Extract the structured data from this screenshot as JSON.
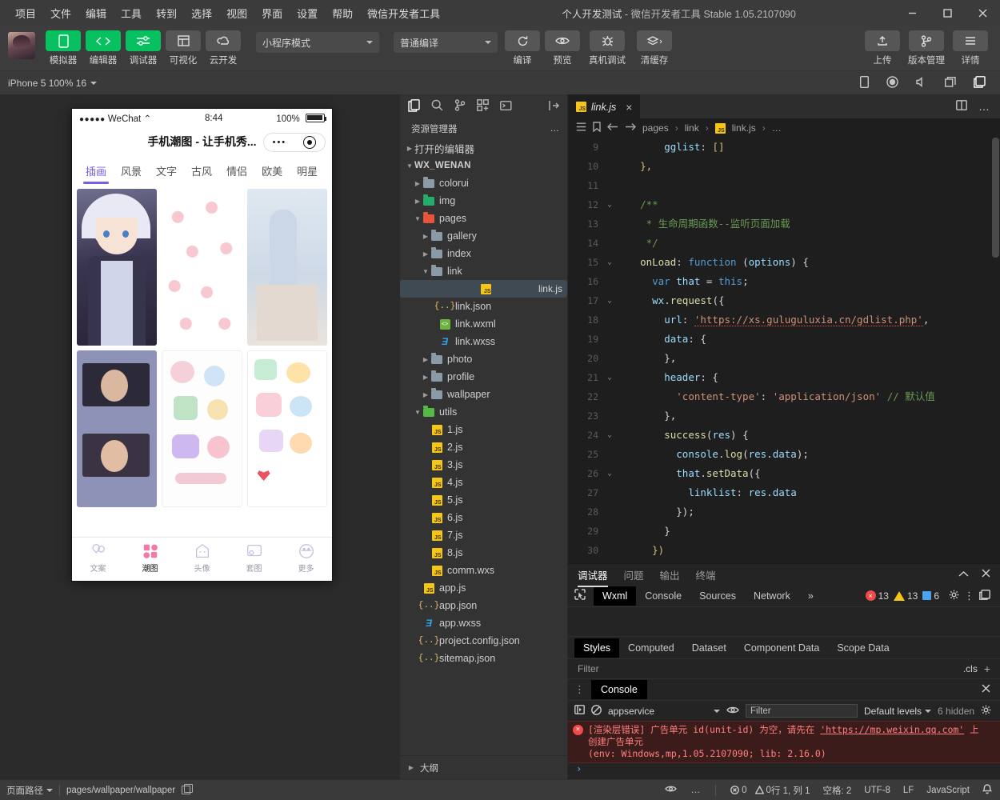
{
  "window": {
    "menus": [
      "项目",
      "文件",
      "编辑",
      "工具",
      "转到",
      "选择",
      "视图",
      "界面",
      "设置",
      "帮助",
      "微信开发者工具"
    ],
    "title_project": "个人开发测试",
    "title_rest": " - 微信开发者工具 Stable 1.05.2107090",
    "minimize": "minimize-icon",
    "maximize": "maximize-icon",
    "close": "close-icon"
  },
  "toolbar": {
    "tools": [
      {
        "label": "模拟器",
        "icon": "phone-icon",
        "style": "green"
      },
      {
        "label": "编辑器",
        "icon": "code-icon",
        "style": "green"
      },
      {
        "label": "调试器",
        "icon": "sliders-icon",
        "style": "green"
      },
      {
        "label": "可视化",
        "icon": "layout-icon",
        "style": "grey"
      },
      {
        "label": "云开发",
        "icon": "cloud-icon",
        "style": "grey"
      }
    ],
    "mode_select": "小程序模式",
    "compile_select": "普通编译",
    "actions": [
      {
        "label": "编译",
        "icon": "refresh-icon"
      },
      {
        "label": "预览",
        "icon": "eye-icon"
      },
      {
        "label": "真机调试",
        "icon": "bug-icon"
      },
      {
        "label": "清缓存",
        "icon": "layers-icon"
      }
    ],
    "right_actions": [
      {
        "label": "上传",
        "icon": "upload-icon"
      },
      {
        "label": "版本管理",
        "icon": "git-branch-icon"
      },
      {
        "label": "详情",
        "icon": "hamburger-icon"
      }
    ]
  },
  "simbar": {
    "device": "iPhone 5 100% 16",
    "icons": [
      "phone-rotate-icon",
      "record-icon",
      "volume-icon",
      "window-icon",
      "split-icon"
    ]
  },
  "simulator": {
    "status": {
      "carrier": "WeChat",
      "dots": "●●●●●",
      "time": "8:44",
      "battery_pct": "100%"
    },
    "nav_title": "手机潮图 - 让手机秀...",
    "tabs": [
      "插画",
      "风景",
      "文字",
      "古风",
      "情侣",
      "欧美",
      "明星"
    ],
    "active_tab": "插画",
    "tabbar": [
      {
        "label": "文案",
        "icon": "balloon-icon"
      },
      {
        "label": "潮图",
        "icon": "grid-icon"
      },
      {
        "label": "头像",
        "icon": "avatar-icon"
      },
      {
        "label": "套图",
        "icon": "album-icon"
      },
      {
        "label": "更多",
        "icon": "more-icon"
      }
    ],
    "active_tabbar": "潮图"
  },
  "explorer": {
    "icons": [
      "files-icon",
      "search-icon",
      "source-control-icon",
      "extensions-icon",
      "debug-icon",
      "collapse-icon"
    ],
    "title": "资源管理器",
    "more": "…",
    "open_editors": "打开的编辑器",
    "project_name": "WX_WENAN",
    "tree": [
      {
        "name": "colorui",
        "depth": 2,
        "type": "folder",
        "open": false
      },
      {
        "name": "img",
        "depth": 2,
        "type": "folder-img",
        "open": false
      },
      {
        "name": "pages",
        "depth": 2,
        "type": "folder-pages",
        "open": true
      },
      {
        "name": "gallery",
        "depth": 3,
        "type": "folder",
        "open": false
      },
      {
        "name": "index",
        "depth": 3,
        "type": "folder",
        "open": false
      },
      {
        "name": "link",
        "depth": 3,
        "type": "folder",
        "open": true
      },
      {
        "name": "link.js",
        "depth": 4,
        "type": "js",
        "selected": true
      },
      {
        "name": "link.json",
        "depth": 4,
        "type": "json"
      },
      {
        "name": "link.wxml",
        "depth": 4,
        "type": "wxml"
      },
      {
        "name": "link.wxss",
        "depth": 4,
        "type": "wxss"
      },
      {
        "name": "photo",
        "depth": 3,
        "type": "folder",
        "open": false
      },
      {
        "name": "profile",
        "depth": 3,
        "type": "folder",
        "open": false
      },
      {
        "name": "wallpaper",
        "depth": 3,
        "type": "folder",
        "open": false
      },
      {
        "name": "utils",
        "depth": 2,
        "type": "folder-utils",
        "open": true
      },
      {
        "name": "1.js",
        "depth": 3,
        "type": "js"
      },
      {
        "name": "2.js",
        "depth": 3,
        "type": "js"
      },
      {
        "name": "3.js",
        "depth": 3,
        "type": "js"
      },
      {
        "name": "4.js",
        "depth": 3,
        "type": "js"
      },
      {
        "name": "5.js",
        "depth": 3,
        "type": "js"
      },
      {
        "name": "6.js",
        "depth": 3,
        "type": "js"
      },
      {
        "name": "7.js",
        "depth": 3,
        "type": "js"
      },
      {
        "name": "8.js",
        "depth": 3,
        "type": "js"
      },
      {
        "name": "comm.wxs",
        "depth": 3,
        "type": "js"
      },
      {
        "name": "app.js",
        "depth": 2,
        "type": "js"
      },
      {
        "name": "app.json",
        "depth": 2,
        "type": "json"
      },
      {
        "name": "app.wxss",
        "depth": 2,
        "type": "wxss"
      },
      {
        "name": "project.config.json",
        "depth": 2,
        "type": "json"
      },
      {
        "name": "sitemap.json",
        "depth": 2,
        "type": "json"
      }
    ],
    "outline": "大纲"
  },
  "editor": {
    "tab": {
      "name": "link.js",
      "icon": "js-icon",
      "close": "×"
    },
    "tab_right_icons": [
      "split-editor-icon",
      "more-icon"
    ],
    "breadcrumb_icons": [
      "outline-icon",
      "bookmark-icon",
      "back-arrow-icon",
      "forward-arrow-icon"
    ],
    "breadcrumb": [
      "pages",
      "link",
      "link.js",
      "…"
    ],
    "lines": [
      {
        "n": "9",
        "fold": "",
        "indent": 4,
        "tokens": [
          [
            "k-key",
            "gglist"
          ],
          [
            "k-pun",
            ": "
          ],
          [
            "k-org",
            "[]"
          ]
        ]
      },
      {
        "n": "10",
        "fold": "",
        "indent": 2,
        "tokens": [
          [
            "k-org",
            "},"
          ]
        ]
      },
      {
        "n": "11",
        "fold": "",
        "indent": 0,
        "tokens": []
      },
      {
        "n": "12",
        "fold": "v",
        "indent": 2,
        "tokens": [
          [
            "k-cmt",
            "/**"
          ]
        ]
      },
      {
        "n": "13",
        "fold": "",
        "indent": 2,
        "tokens": [
          [
            "k-cmt",
            " * 生命周期函数--监听页面加载"
          ]
        ]
      },
      {
        "n": "14",
        "fold": "",
        "indent": 2,
        "tokens": [
          [
            "k-cmt",
            " */"
          ]
        ]
      },
      {
        "n": "15",
        "fold": "v",
        "indent": 2,
        "tokens": [
          [
            "k-y",
            "onLoad"
          ],
          [
            "k-pun",
            ": "
          ],
          [
            "k-blue",
            "function"
          ],
          [
            "k-pun",
            " ("
          ],
          [
            "k-key",
            "options"
          ],
          [
            "k-pun",
            ") {"
          ]
        ]
      },
      {
        "n": "16",
        "fold": "",
        "indent": 3,
        "tokens": [
          [
            "k-blue",
            "var"
          ],
          [
            "k-pun",
            " "
          ],
          [
            "k-key",
            "that"
          ],
          [
            "k-pun",
            " = "
          ],
          [
            "k-blue",
            "this"
          ],
          [
            "k-pun",
            ";"
          ]
        ]
      },
      {
        "n": "17",
        "fold": "v",
        "indent": 3,
        "tokens": [
          [
            "k-key",
            "wx"
          ],
          [
            "k-pun",
            "."
          ],
          [
            "k-y",
            "request"
          ],
          [
            "k-pun",
            "({"
          ]
        ]
      },
      {
        "n": "18",
        "fold": "",
        "indent": 4,
        "tokens": [
          [
            "k-key",
            "url"
          ],
          [
            "k-pun",
            ": "
          ],
          [
            "k-str-err",
            "'https://xs.guluguluxia.cn/gdlist.php'"
          ],
          [
            "k-pun",
            ","
          ]
        ]
      },
      {
        "n": "19",
        "fold": "",
        "indent": 4,
        "tokens": [
          [
            "k-key",
            "data"
          ],
          [
            "k-pun",
            ": {"
          ]
        ]
      },
      {
        "n": "20",
        "fold": "",
        "indent": 4,
        "tokens": [
          [
            "k-pun",
            "},"
          ]
        ]
      },
      {
        "n": "21",
        "fold": "v",
        "indent": 4,
        "tokens": [
          [
            "k-key",
            "header"
          ],
          [
            "k-pun",
            ": {"
          ]
        ]
      },
      {
        "n": "22",
        "fold": "",
        "indent": 5,
        "tokens": [
          [
            "k-str",
            "'content-type'"
          ],
          [
            "k-pun",
            ": "
          ],
          [
            "k-str",
            "'application/json'"
          ],
          [
            "k-pun",
            " "
          ],
          [
            "k-cmt",
            "// 默认值"
          ]
        ]
      },
      {
        "n": "23",
        "fold": "",
        "indent": 4,
        "tokens": [
          [
            "k-pun",
            "},"
          ]
        ]
      },
      {
        "n": "24",
        "fold": "v",
        "indent": 4,
        "tokens": [
          [
            "k-y",
            "success"
          ],
          [
            "k-pun",
            "("
          ],
          [
            "k-key",
            "res"
          ],
          [
            "k-pun",
            ") {"
          ]
        ]
      },
      {
        "n": "25",
        "fold": "",
        "indent": 5,
        "tokens": [
          [
            "k-key",
            "console"
          ],
          [
            "k-pun",
            "."
          ],
          [
            "k-y",
            "log"
          ],
          [
            "k-pun",
            "("
          ],
          [
            "k-key",
            "res"
          ],
          [
            "k-pun",
            "."
          ],
          [
            "k-key",
            "data"
          ],
          [
            "k-pun",
            ");"
          ]
        ]
      },
      {
        "n": "26",
        "fold": "v",
        "indent": 5,
        "tokens": [
          [
            "k-key",
            "that"
          ],
          [
            "k-pun",
            "."
          ],
          [
            "k-y",
            "setData"
          ],
          [
            "k-pun",
            "({"
          ]
        ]
      },
      {
        "n": "27",
        "fold": "",
        "indent": 6,
        "tokens": [
          [
            "k-key",
            "linklist"
          ],
          [
            "k-pun",
            ": "
          ],
          [
            "k-key",
            "res"
          ],
          [
            "k-pun",
            "."
          ],
          [
            "k-key",
            "data"
          ]
        ]
      },
      {
        "n": "28",
        "fold": "",
        "indent": 5,
        "tokens": [
          [
            "k-pun",
            "});"
          ]
        ]
      },
      {
        "n": "29",
        "fold": "",
        "indent": 4,
        "tokens": [
          [
            "k-pun",
            "}"
          ]
        ]
      },
      {
        "n": "30",
        "fold": "",
        "indent": 3,
        "tokens": [
          [
            "k-org",
            "})"
          ]
        ]
      }
    ]
  },
  "debugger": {
    "panel_tabs": [
      "调试器",
      "问题",
      "输出",
      "终端"
    ],
    "panel_active": "调试器",
    "panel_right_icons": [
      "chevron-up-icon",
      "close-icon"
    ],
    "devtools_tabs": [
      "Wxml",
      "Console",
      "Sources",
      "Network"
    ],
    "devtools_active": "Wxml",
    "devtools_overflow": "»",
    "inspect_icon": "inspect-icon",
    "counts": {
      "errors": "13",
      "warnings": "13",
      "info": "6"
    },
    "right_icons": [
      "gear-icon",
      "kebab-icon",
      "dock-icon"
    ],
    "styles_tabs": [
      "Styles",
      "Computed",
      "Dataset",
      "Component Data",
      "Scope Data"
    ],
    "styles_active": "Styles",
    "filter_placeholder": "Filter",
    "cls_label": ".cls",
    "plus": "+"
  },
  "console": {
    "drag_icon": "drag-handle-icon",
    "tab": "Console",
    "close": "close-icon",
    "exec_icon": "execute-icon",
    "clear_icon": "clear-icon",
    "context": "appservice",
    "eye_icon": "eye-icon",
    "filter_placeholder": "Filter",
    "levels": "Default levels",
    "hidden": "6 hidden",
    "settings_icon": "gear-icon",
    "error": {
      "prefix": "[渲染层错误] 广告单元 id(unit-id) 为空，请先在 ",
      "link": "'https://mp.weixin.qq.com'",
      "suffix": " 上",
      "line2": "创建广告单元",
      "line3": "(env: Windows,mp,1.05.2107090; lib: 2.16.0)"
    },
    "prompt": "›"
  },
  "status": {
    "page_path_label": "页面路径",
    "page_path": "pages/wallpaper/wallpaper",
    "copy_icon": "copy-icon",
    "eye_icon": "eye-icon",
    "more_icon": "more-icon",
    "err_count": "0",
    "warn_count": "0",
    "cursor": "行 1, 列 1",
    "spaces": "空格: 2",
    "encoding": "UTF-8",
    "eol": "LF",
    "language": "JavaScript",
    "bell_icon": "bell-icon"
  },
  "colors": {
    "accent_green": "#07c160",
    "purple": "#7b5ce6",
    "error_red": "#f04a4a",
    "warn_yellow": "#f5c518"
  }
}
